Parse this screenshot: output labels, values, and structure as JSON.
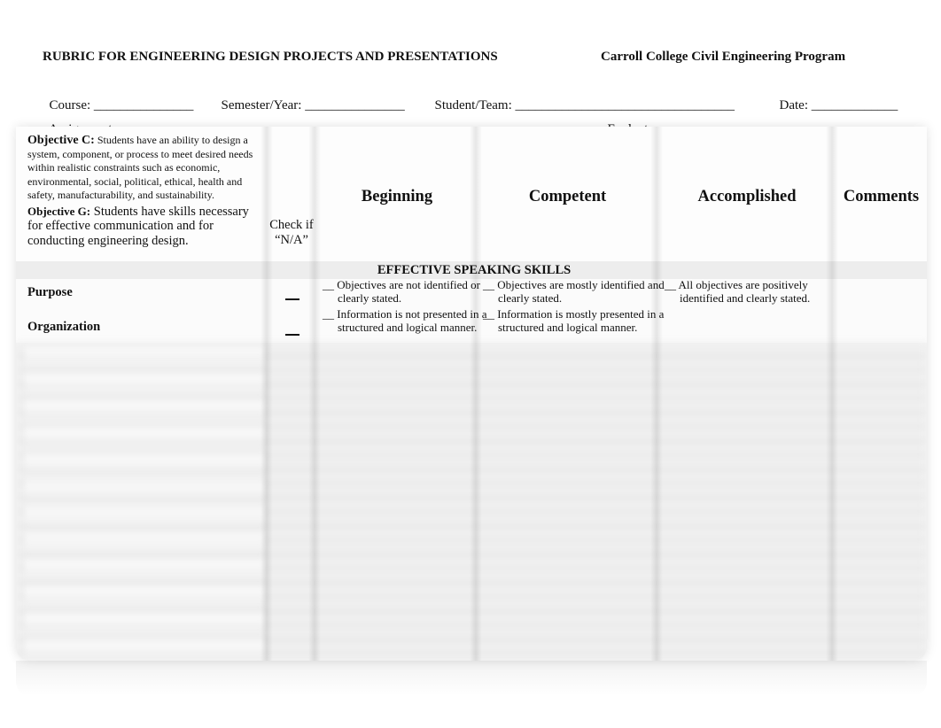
{
  "header": {
    "title": "RUBRIC FOR ENGINEERING DESIGN PROJECTS AND PRESENTATIONS",
    "organization": "Carroll College Civil Engineering Program"
  },
  "fields": {
    "course_label": "Course:",
    "course_value": "_______________",
    "semester_label": "Semester/Year:",
    "semester_value": "_______________",
    "student_label": "Student/Team:",
    "student_value": "_________________________________",
    "date_label": "Date:",
    "date_value": "_____________",
    "assignment_label": "Assignment:",
    "assignment_value": "_________________________________________________________________",
    "evaluator_label": "Evaluator:",
    "evaluator_value": "__________________________________"
  },
  "table": {
    "objective_c_label": "Objective C:",
    "objective_c_text": "Students have an ability to design a system, component, or process to meet desired needs within realistic constraints such as economic, environmental, social, political, ethical, health and safety, manufacturability, and sustainability.",
    "objective_g_label": "Objective G:",
    "objective_g_text": "Students have skills necessary for effective communication and for conducting engineering design.",
    "check_na": "Check if “N/A”",
    "columns": [
      "Beginning",
      "Competent",
      "Accomplished",
      "Comments"
    ],
    "section_title": "EFFECTIVE SPEAKING SKILLS",
    "rows": [
      {
        "criterion": "Purpose",
        "na": "__",
        "beginning": "__ Objectives are not identified or clearly stated.",
        "competent": "__ Objectives are mostly identified and clearly stated.",
        "accomplished": "__ All objectives are positively identified and clearly stated.",
        "comments": ""
      },
      {
        "criterion": "Organization",
        "na": "__",
        "beginning": "__ Information is not presented in a structured and logical manner.",
        "competent": "__ Information is mostly presented in a structured and logical manner.",
        "accomplished": "",
        "comments": ""
      }
    ]
  }
}
